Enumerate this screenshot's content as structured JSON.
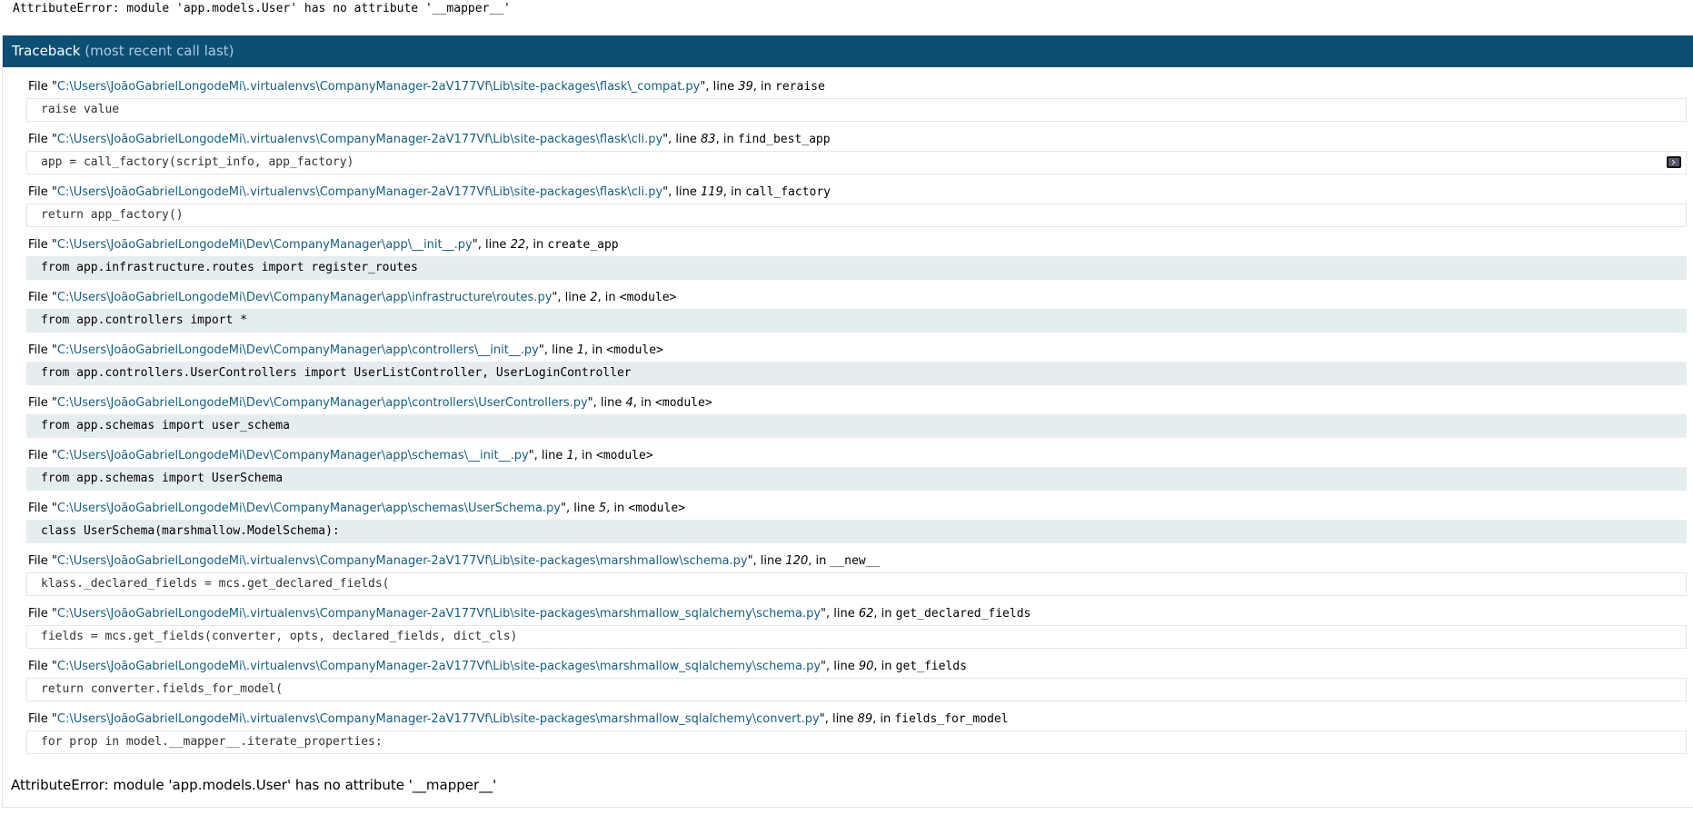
{
  "top_error": "AttributeError: module 'app.models.User' has no attribute '__mapper__'",
  "traceback": {
    "title": "Traceback",
    "subtitle": "(most recent call last)"
  },
  "frames": [
    {
      "path": "C:\\Users\\JoãoGabrielLongodeMi\\.virtualenvs\\CompanyManager-2aV177Vf\\Lib\\site-packages\\flask\\_compat.py",
      "line": "39",
      "func": "reraise",
      "code": "raise value",
      "app": false
    },
    {
      "path": "C:\\Users\\JoãoGabrielLongodeMi\\.virtualenvs\\CompanyManager-2aV177Vf\\Lib\\site-packages\\flask\\cli.py",
      "line": "83",
      "func": "find_best_app",
      "code": "app = call_factory(script_info, app_factory)",
      "app": false,
      "console": true
    },
    {
      "path": "C:\\Users\\JoãoGabrielLongodeMi\\.virtualenvs\\CompanyManager-2aV177Vf\\Lib\\site-packages\\flask\\cli.py",
      "line": "119",
      "func": "call_factory",
      "code": "return app_factory()",
      "app": false
    },
    {
      "path": "C:\\Users\\JoãoGabrielLongodeMi\\Dev\\CompanyManager\\app\\__init__.py",
      "line": "22",
      "func": "create_app",
      "code": "from app.infrastructure.routes import register_routes",
      "app": true
    },
    {
      "path": "C:\\Users\\JoãoGabrielLongodeMi\\Dev\\CompanyManager\\app\\infrastructure\\routes.py",
      "line": "2",
      "func": "<module>",
      "code": "from app.controllers import *",
      "app": true
    },
    {
      "path": "C:\\Users\\JoãoGabrielLongodeMi\\Dev\\CompanyManager\\app\\controllers\\__init__.py",
      "line": "1",
      "func": "<module>",
      "code": "from app.controllers.UserControllers import UserListController, UserLoginController",
      "app": true
    },
    {
      "path": "C:\\Users\\JoãoGabrielLongodeMi\\Dev\\CompanyManager\\app\\controllers\\UserControllers.py",
      "line": "4",
      "func": "<module>",
      "code": "from app.schemas import user_schema",
      "app": true
    },
    {
      "path": "C:\\Users\\JoãoGabrielLongodeMi\\Dev\\CompanyManager\\app\\schemas\\__init__.py",
      "line": "1",
      "func": "<module>",
      "code": "from app.schemas import UserSchema",
      "app": true
    },
    {
      "path": "C:\\Users\\JoãoGabrielLongodeMi\\Dev\\CompanyManager\\app\\schemas\\UserSchema.py",
      "line": "5",
      "func": "<module>",
      "code": "class UserSchema(marshmallow.ModelSchema):",
      "app": true
    },
    {
      "path": "C:\\Users\\JoãoGabrielLongodeMi\\.virtualenvs\\CompanyManager-2aV177Vf\\Lib\\site-packages\\marshmallow\\schema.py",
      "line": "120",
      "func": "__new__",
      "code": "klass._declared_fields = mcs.get_declared_fields(",
      "app": false
    },
    {
      "path": "C:\\Users\\JoãoGabrielLongodeMi\\.virtualenvs\\CompanyManager-2aV177Vf\\Lib\\site-packages\\marshmallow_sqlalchemy\\schema.py",
      "line": "62",
      "func": "get_declared_fields",
      "code": "fields = mcs.get_fields(converter, opts, declared_fields, dict_cls)",
      "app": false
    },
    {
      "path": "C:\\Users\\JoãoGabrielLongodeMi\\.virtualenvs\\CompanyManager-2aV177Vf\\Lib\\site-packages\\marshmallow_sqlalchemy\\schema.py",
      "line": "90",
      "func": "get_fields",
      "code": "return converter.fields_for_model(",
      "app": false
    },
    {
      "path": "C:\\Users\\JoãoGabrielLongodeMi\\.virtualenvs\\CompanyManager-2aV177Vf\\Lib\\site-packages\\marshmallow_sqlalchemy\\convert.py",
      "line": "89",
      "func": "fields_for_model",
      "code": "for prop in model.__mapper__.iterate_properties:",
      "app": false
    }
  ],
  "labels": {
    "file": "File ",
    "line": ", line ",
    "in": ", in "
  },
  "bottom_error": "AttributeError: module 'app.models.User' has no attribute '__mapper__'",
  "colors": {
    "header_bg": "#0d4f74",
    "path": "#155f80",
    "app_source_bg": "#e6edee"
  },
  "icons": {
    "console": "console-icon"
  }
}
